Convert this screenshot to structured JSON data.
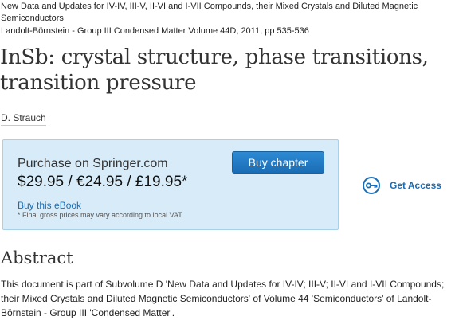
{
  "header": {
    "series_title": "New Data and Updates for IV-IV, III-V, II-VI and I-VII Compounds, their Mixed Crystals and Diluted Magnetic Semiconductors",
    "publication": "Landolt-Börnstein - Group III Condensed Matter Volume 44D, 2011, pp 535-536"
  },
  "title": "InSb: crystal structure, phase transitions, transition pressure",
  "author": "D. Strauch",
  "purchase": {
    "heading": "Purchase on Springer.com",
    "price": "$29.95 / €24.95 / £19.95*",
    "buy_button": "Buy chapter",
    "ebook_link": "Buy this eBook",
    "vat_note": "* Final gross prices may vary according to local VAT."
  },
  "access": {
    "label": "Get Access",
    "icon": "key-icon"
  },
  "abstract": {
    "heading": "Abstract",
    "text": "This document is part of Subvolume D 'New Data and Updates for IV-IV; III-V; II-VI and I-VII Compounds; their Mixed Crystals and Diluted Magnetic Semiconductors' of Volume 44 'Semiconductors' of Landolt-Börnstein - Group III 'Condensed Matter'."
  },
  "colors": {
    "accent": "#1a6db5",
    "box_background": "#d7ebf8",
    "box_border": "#a9cfe9"
  }
}
